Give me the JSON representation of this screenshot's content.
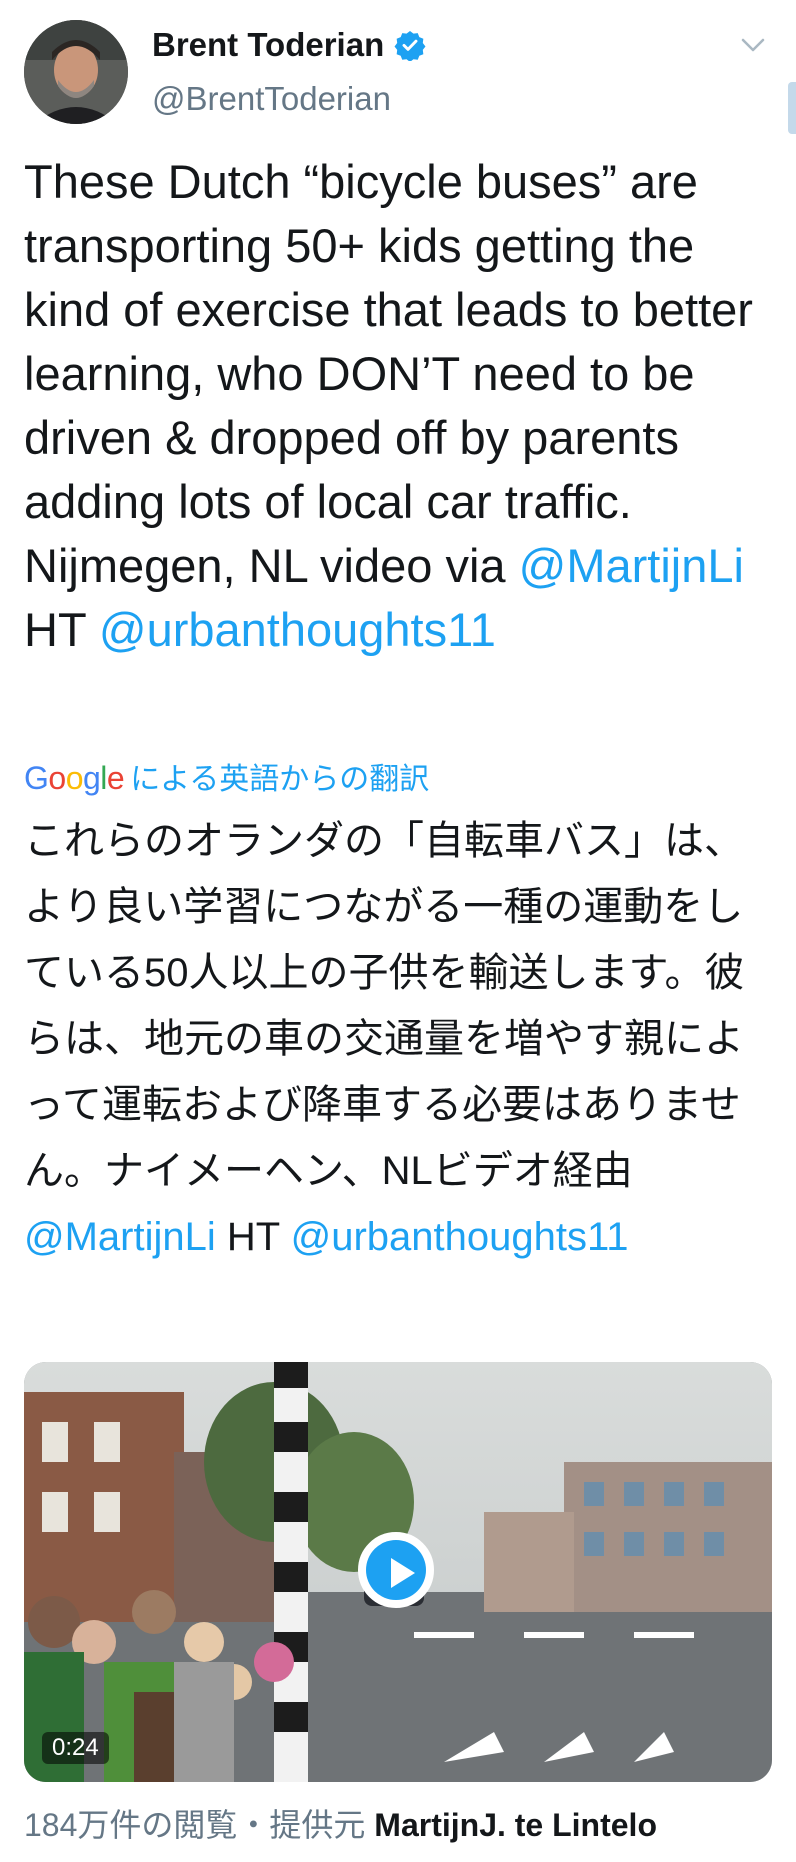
{
  "user": {
    "display_name": "Brent Toderian",
    "handle": "@BrentToderian",
    "verified": true
  },
  "tweet": {
    "text_main": "These Dutch “bicycle buses” are transporting 50+ kids getting the kind of exercise that leads to better learning, who DON’T need to be driven & dropped off by parents adding lots of local car traffic. Nijmegen, NL video via ",
    "mention_1": "@MartijnLi",
    "text_ht": " HT ",
    "mention_2": "@urbanthoughts11"
  },
  "translation": {
    "google_label": "Google",
    "label": "による英語からの翻訳",
    "text_main": "これらのオランダの「自転車バス」は、より良い学習につながる一種の運動をしている50人以上の子供を輸送します。彼らは、地元の車の交通量を増やす親によって運転および降車する必要はありません。ナイメーヘン、NLビデオ経由",
    "mention_1": "@MartijnLi",
    "text_ht": " HT ",
    "mention_2": "@urbanthoughts11"
  },
  "media": {
    "duration": "0:24",
    "views_label": "184万件の閲覧・提供元 ",
    "provider": "MartijnJ. te Lintelo"
  },
  "colors": {
    "link": "#1da1f2",
    "text": "#14171a",
    "secondary": "#657786"
  },
  "icons": [
    "verified-badge-icon",
    "chevron-down-icon",
    "play-icon"
  ]
}
